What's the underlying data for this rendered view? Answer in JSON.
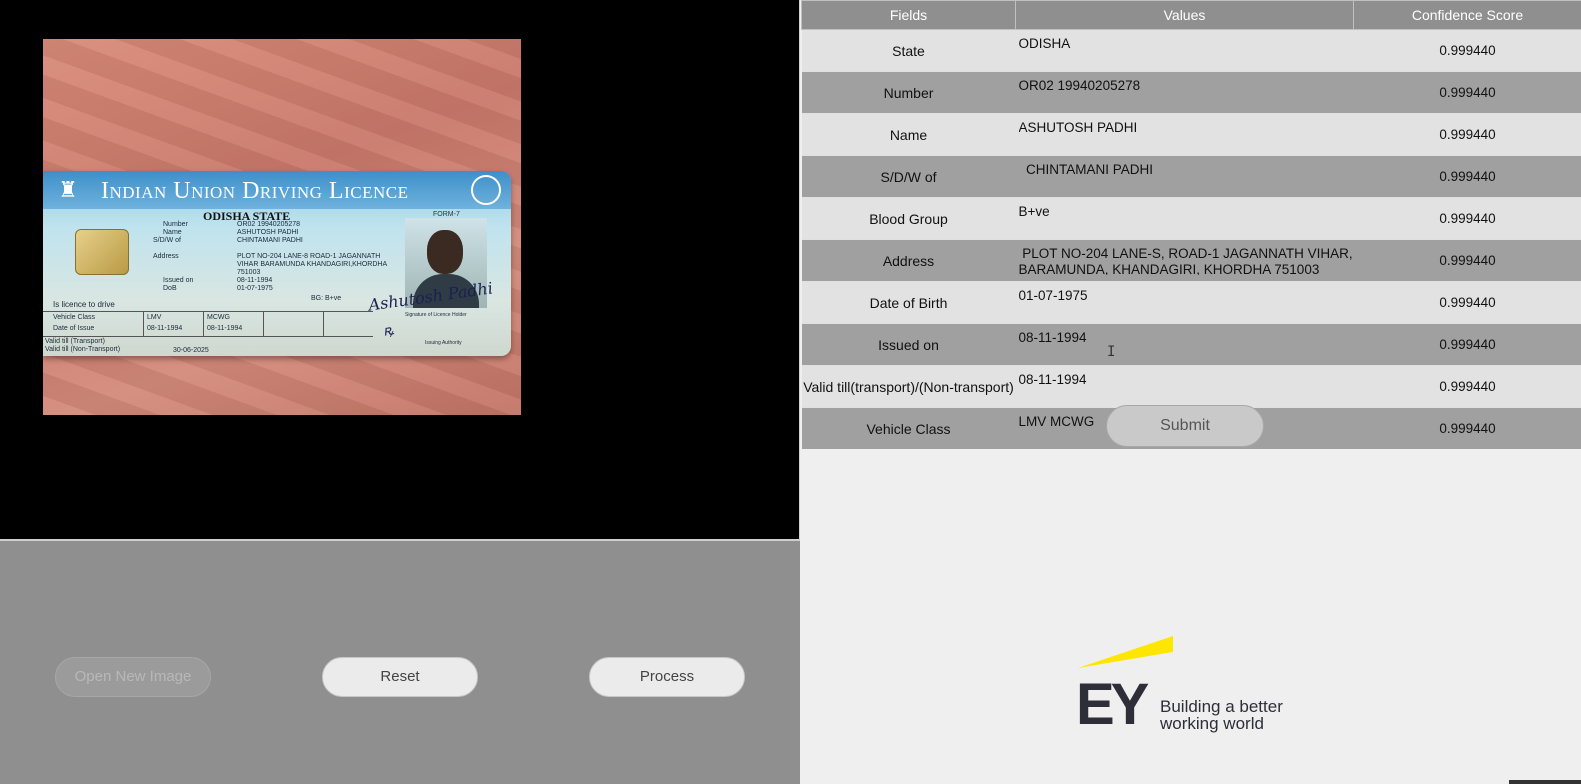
{
  "viewer": {
    "card": {
      "title": "Indian Union Driving Licence",
      "state": "ODISHA STATE",
      "form": "FORM-7",
      "rows": [
        {
          "label": "Number",
          "value": "OR02 19940205278"
        },
        {
          "label": "Name",
          "value": "ASHUTOSH PADHI"
        },
        {
          "label": "S/D/W of",
          "value": "CHINTAMANI PADHI"
        },
        {
          "label": "Address",
          "value": "PLOT NO-204 LANE-8 ROAD-1 JAGANNATH VIHAR BARAMUNDA KHANDAGIRI,KHORDHA 751003"
        },
        {
          "label": "Issued on",
          "value": "08-11-1994"
        },
        {
          "label": "DoB",
          "value": "01-07-1975"
        }
      ],
      "blood_group": "BG: B+ve",
      "licence_to_drive": "Is licence to drive",
      "vehicle_class_label": "Vehicle Class",
      "vehicle_class_values": [
        "LMV",
        "MCWG"
      ],
      "date_of_issue_label": "Date of Issue",
      "date_of_issue_values": [
        "08-11-1994",
        "08-11-1994"
      ],
      "valid_transport": "Valid till (Transport)",
      "valid_non_transport": "Valid till (Non-Transport)",
      "valid_date": "30-06-2025",
      "signature": "Ashutosh Padhi",
      "signature_label": "Signature of Licence Holder",
      "authority_label": "Issuing Authority"
    }
  },
  "controls": {
    "open_label": "Open New Image",
    "reset_label": "Reset",
    "process_label": "Process"
  },
  "results": {
    "headers": [
      "Fields",
      "Values",
      "Confidence Score"
    ],
    "rows": [
      {
        "field": "State",
        "value": "ODISHA",
        "score": "0.999440"
      },
      {
        "field": "Number",
        "value": "OR02 19940205278",
        "score": "0.999440"
      },
      {
        "field": "Name",
        "value": "ASHUTOSH PADHI",
        "score": "0.999440"
      },
      {
        "field": "S/D/W of",
        "value": "  CHINTAMANI PADHI",
        "score": "0.999440"
      },
      {
        "field": "Blood Group",
        "value": "B+ve",
        "score": "0.999440"
      },
      {
        "field": "Address",
        "value": " PLOT NO-204 LANE-S, ROAD-1 JAGANNATH VIHAR, BARAMUNDA, KHANDAGIRI, KHORDHA 751003",
        "score": "0.999440"
      },
      {
        "field": "Date of Birth",
        "value": "01-07-1975",
        "score": "0.999440"
      },
      {
        "field": "Issued on",
        "value": "08-11-1994",
        "score": "0.999440"
      },
      {
        "field": "Valid till(transport)/(Non-transport)",
        "value": "08-11-1994",
        "score": "0.999440"
      },
      {
        "field": "Vehicle Class",
        "value": "LMV MCWG",
        "score": "0.999440"
      }
    ],
    "submit_label": "Submit"
  },
  "logo": {
    "letters": "EY",
    "tagline_line1": "Building a better",
    "tagline_line2": "working world",
    "accent_color": "#ffe600"
  }
}
